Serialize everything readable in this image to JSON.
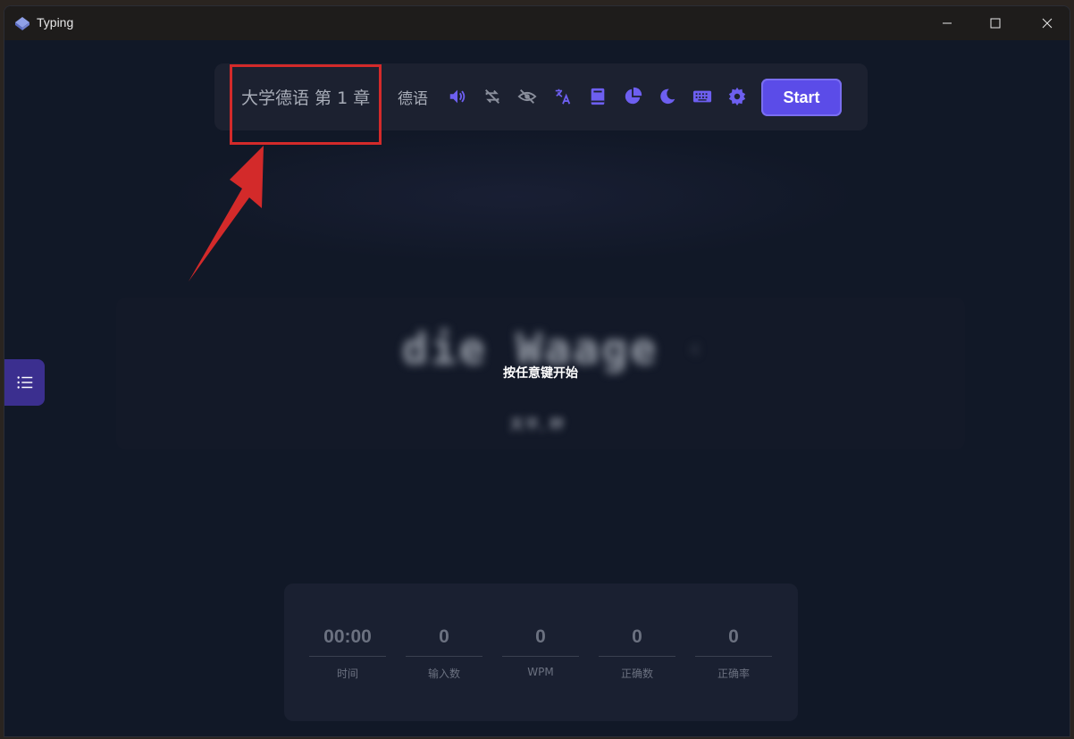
{
  "window": {
    "title": "Typing"
  },
  "toolbar": {
    "dictionary": "大学德语 第 1 章",
    "language": "德语",
    "start_label": "Start",
    "icons": [
      "speaker-icon",
      "loop-icon",
      "eye-off-icon",
      "translate-icon",
      "book-icon",
      "pie-chart-icon",
      "moon-icon",
      "keyboard-icon",
      "gear-icon"
    ],
    "accent": "#5b4ce8",
    "icon_color": "#6d5ff0"
  },
  "word_panel": {
    "word": "die Waage",
    "hint": "按任意键开始",
    "translation": "天平, 秤"
  },
  "stats": [
    {
      "value": "00:00",
      "label": "时间"
    },
    {
      "value": "0",
      "label": "输入数"
    },
    {
      "value": "0",
      "label": "WPM"
    },
    {
      "value": "0",
      "label": "正确数"
    },
    {
      "value": "0",
      "label": "正确率"
    }
  ],
  "annotation": {
    "color": "#d32a2a"
  }
}
